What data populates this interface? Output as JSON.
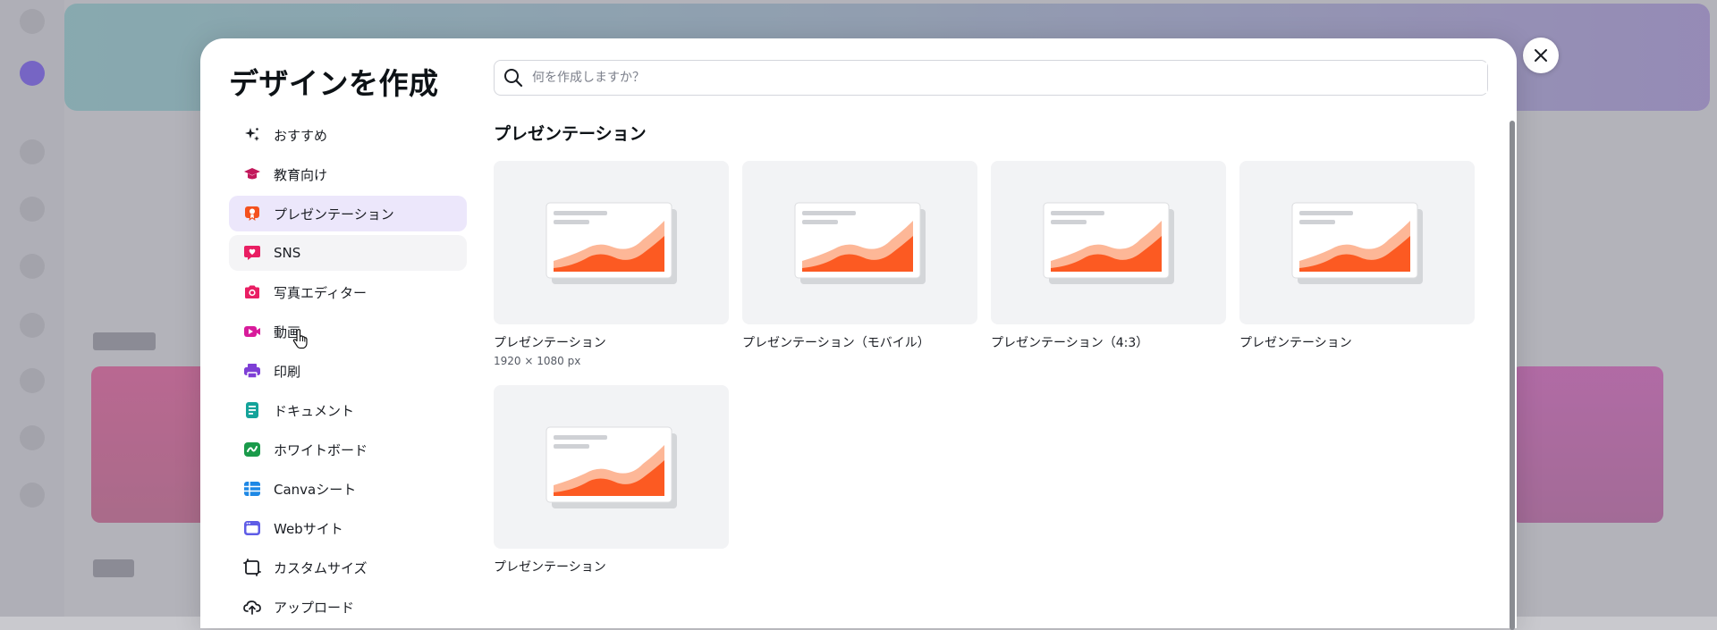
{
  "modal": {
    "title": "デザインを作成",
    "search_placeholder": "何を作成しますか？"
  },
  "sidebar": {
    "items": [
      {
        "label": "おすすめ",
        "icon": "sparkle-icon",
        "color": "#1a1d23"
      },
      {
        "label": "教育向け",
        "icon": "graduation-cap-icon",
        "color": "#c2185b"
      },
      {
        "label": "プレゼンテーション",
        "icon": "presentation-award-icon",
        "color": "#f4511e"
      },
      {
        "label": "SNS",
        "icon": "heart-chat-icon",
        "color": "#e91e63"
      },
      {
        "label": "写真エディター",
        "icon": "camera-icon",
        "color": "#e91e63"
      },
      {
        "label": "動画",
        "icon": "video-icon",
        "color": "#d81b9b"
      },
      {
        "label": "印刷",
        "icon": "printer-icon",
        "color": "#7e3fd6"
      },
      {
        "label": "ドキュメント",
        "icon": "document-icon",
        "color": "#14a39a"
      },
      {
        "label": "ホワイトボード",
        "icon": "whiteboard-icon",
        "color": "#1a9a4a"
      },
      {
        "label": "Canvaシート",
        "icon": "sheet-icon",
        "color": "#1e88e5"
      },
      {
        "label": "Webサイト",
        "icon": "website-icon",
        "color": "#5e5ce6"
      },
      {
        "label": "カスタムサイズ",
        "icon": "custom-size-icon",
        "color": "#1a1d23"
      },
      {
        "label": "アップロード",
        "icon": "upload-cloud-icon",
        "color": "#1a1d23"
      }
    ]
  },
  "content": {
    "section_title": "プレゼンテーション",
    "cards": [
      {
        "label": "プレゼンテーション",
        "sub": "1920 × 1080 px"
      },
      {
        "label": "プレゼンテーション（モバイル）",
        "sub": ""
      },
      {
        "label": "プレゼンテーション（4:3）",
        "sub": ""
      },
      {
        "label": "プレゼンテーション",
        "sub": ""
      },
      {
        "label": "プレゼンテーション",
        "sub": ""
      }
    ]
  },
  "colors": {
    "accent_active_bg": "#ece7fb",
    "chart_dark": "#fc5a22",
    "chart_light": "#fdb797"
  }
}
